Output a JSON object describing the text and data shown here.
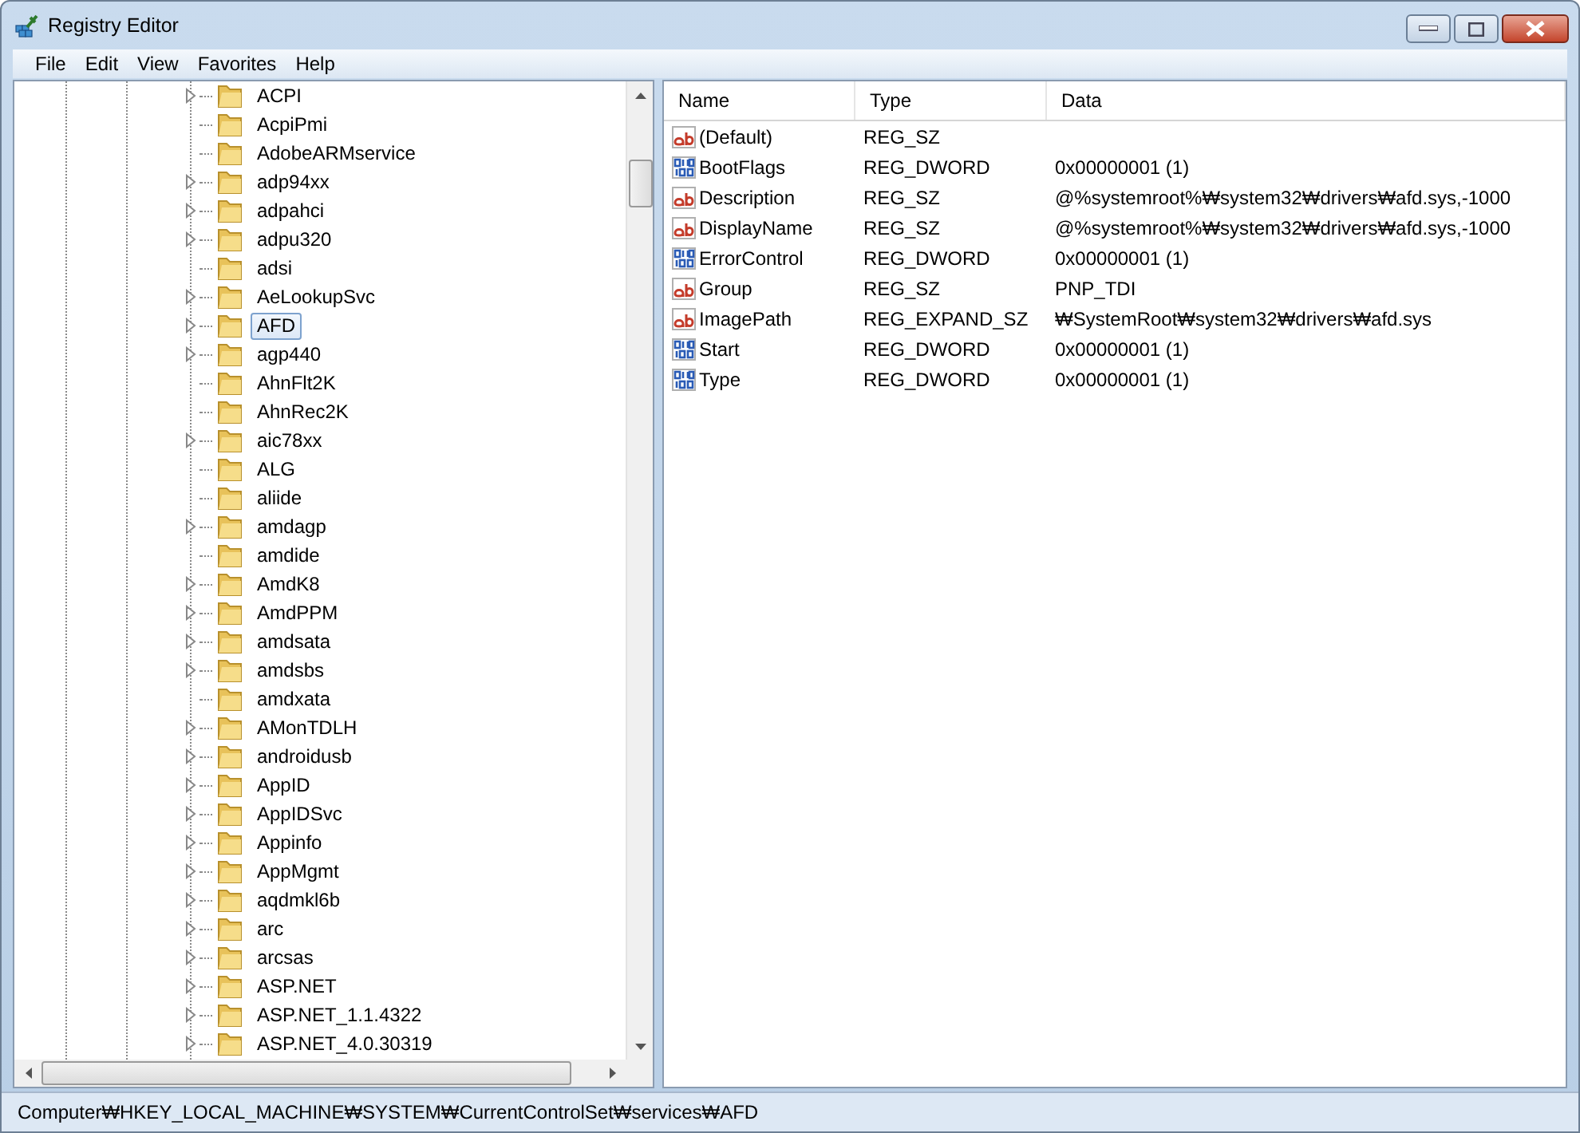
{
  "window": {
    "title": "Registry Editor"
  },
  "menu": [
    {
      "label": "File"
    },
    {
      "label": "Edit"
    },
    {
      "label": "View"
    },
    {
      "label": "Favorites"
    },
    {
      "label": "Help"
    }
  ],
  "tree": [
    {
      "label": "ACPI",
      "expandable": true,
      "selected": false
    },
    {
      "label": "AcpiPmi",
      "expandable": false,
      "selected": false
    },
    {
      "label": "AdobeARMservice",
      "expandable": false,
      "selected": false
    },
    {
      "label": "adp94xx",
      "expandable": true,
      "selected": false
    },
    {
      "label": "adpahci",
      "expandable": true,
      "selected": false
    },
    {
      "label": "adpu320",
      "expandable": true,
      "selected": false
    },
    {
      "label": "adsi",
      "expandable": false,
      "selected": false
    },
    {
      "label": "AeLookupSvc",
      "expandable": true,
      "selected": false
    },
    {
      "label": "AFD",
      "expandable": true,
      "selected": true
    },
    {
      "label": "agp440",
      "expandable": true,
      "selected": false
    },
    {
      "label": "AhnFlt2K",
      "expandable": false,
      "selected": false
    },
    {
      "label": "AhnRec2K",
      "expandable": false,
      "selected": false
    },
    {
      "label": "aic78xx",
      "expandable": true,
      "selected": false
    },
    {
      "label": "ALG",
      "expandable": false,
      "selected": false
    },
    {
      "label": "aliide",
      "expandable": false,
      "selected": false
    },
    {
      "label": "amdagp",
      "expandable": true,
      "selected": false
    },
    {
      "label": "amdide",
      "expandable": false,
      "selected": false
    },
    {
      "label": "AmdK8",
      "expandable": true,
      "selected": false
    },
    {
      "label": "AmdPPM",
      "expandable": true,
      "selected": false
    },
    {
      "label": "amdsata",
      "expandable": true,
      "selected": false
    },
    {
      "label": "amdsbs",
      "expandable": true,
      "selected": false
    },
    {
      "label": "amdxata",
      "expandable": false,
      "selected": false
    },
    {
      "label": "AMonTDLH",
      "expandable": true,
      "selected": false
    },
    {
      "label": "androidusb",
      "expandable": true,
      "selected": false
    },
    {
      "label": "AppID",
      "expandable": true,
      "selected": false
    },
    {
      "label": "AppIDSvc",
      "expandable": true,
      "selected": false
    },
    {
      "label": "Appinfo",
      "expandable": true,
      "selected": false
    },
    {
      "label": "AppMgmt",
      "expandable": true,
      "selected": false
    },
    {
      "label": "aqdmkl6b",
      "expandable": true,
      "selected": false
    },
    {
      "label": "arc",
      "expandable": true,
      "selected": false
    },
    {
      "label": "arcsas",
      "expandable": true,
      "selected": false
    },
    {
      "label": "ASP.NET",
      "expandable": true,
      "selected": false
    },
    {
      "label": "ASP.NET_1.1.4322",
      "expandable": true,
      "selected": false
    },
    {
      "label": "ASP.NET_4.0.30319",
      "expandable": true,
      "selected": false
    }
  ],
  "values_table": {
    "columns": [
      "Name",
      "Type",
      "Data"
    ],
    "rows": [
      {
        "kind": "string",
        "name": "(Default)",
        "type": "REG_SZ"
      },
      {
        "kind": "binary",
        "name": "BootFlags",
        "type": "REG_DWORD",
        "data": "0x00000001 (1)"
      },
      {
        "kind": "string",
        "name": "Description",
        "type": "REG_SZ",
        "data": "@%systemroot%₩system32₩drivers₩afd.sys,-1000"
      },
      {
        "kind": "string",
        "name": "DisplayName",
        "type": "REG_SZ",
        "data": "@%systemroot%₩system32₩drivers₩afd.sys,-1000"
      },
      {
        "kind": "binary",
        "name": "ErrorControl",
        "type": "REG_DWORD",
        "data": "0x00000001 (1)"
      },
      {
        "kind": "string",
        "name": "Group",
        "type": "REG_SZ",
        "data": "PNP_TDI"
      },
      {
        "kind": "string",
        "name": "ImagePath",
        "type": "REG_EXPAND_SZ",
        "data": "₩SystemRoot₩system32₩drivers₩afd.sys"
      },
      {
        "kind": "binary",
        "name": "Start",
        "type": "REG_DWORD",
        "data": "0x00000001 (1)"
      },
      {
        "kind": "binary",
        "name": "Type",
        "type": "REG_DWORD",
        "data": "0x00000001 (1)"
      }
    ]
  },
  "status_bar": "Computer₩HKEY_LOCAL_MACHINE₩SYSTEM₩CurrentControlSet₩services₩AFD"
}
